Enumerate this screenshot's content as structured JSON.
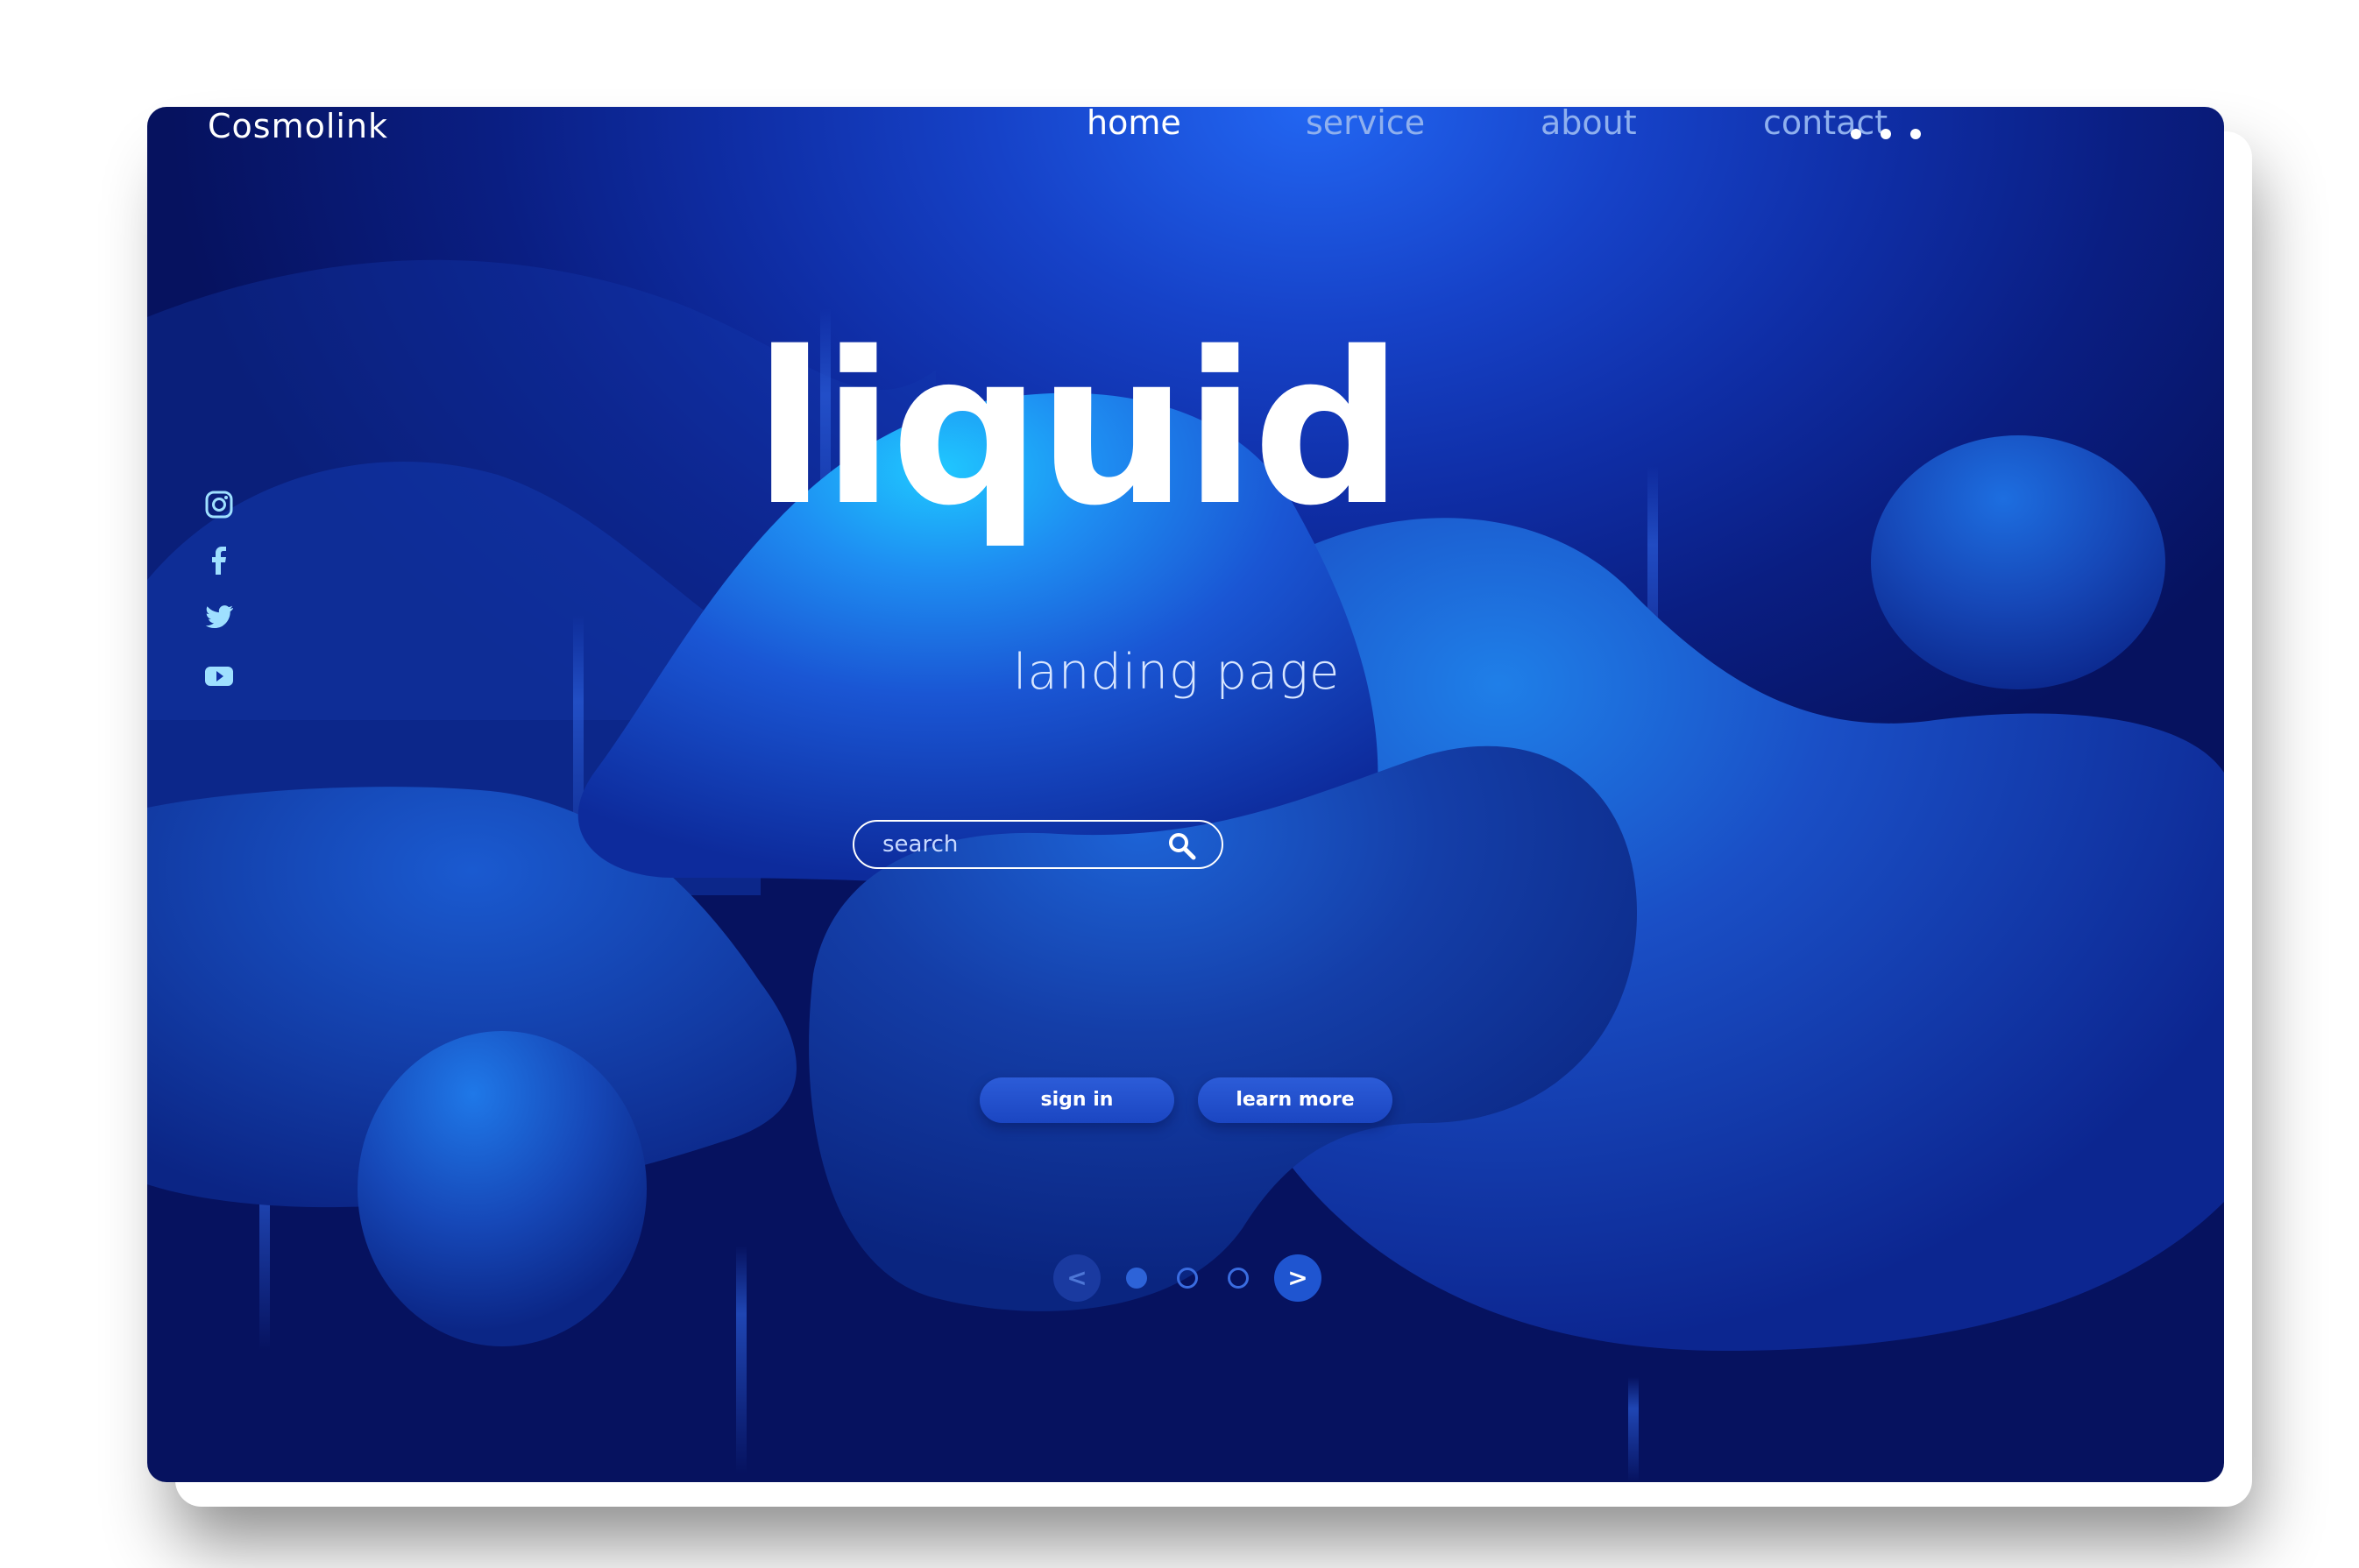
{
  "brand": {
    "name": "Cosmolink"
  },
  "nav": {
    "items": [
      {
        "label": "home",
        "active": true
      },
      {
        "label": "service",
        "active": false
      },
      {
        "label": "about",
        "active": false
      },
      {
        "label": "contact",
        "active": false
      }
    ],
    "more_icon": "more-horizontal-icon"
  },
  "social": {
    "icons": [
      "instagram-icon",
      "facebook-icon",
      "twitter-icon",
      "youtube-icon"
    ]
  },
  "hero": {
    "title": "liquid",
    "subtitle": "landing page"
  },
  "search": {
    "placeholder": "search",
    "value": "",
    "icon": "search-icon"
  },
  "actions": {
    "sign_in_label": "sign in",
    "learn_more_label": "learn more"
  },
  "pager": {
    "prev_label": "<",
    "next_label": ">",
    "total_dots": 3,
    "active_index": 0
  },
  "colors": {
    "background_dark": "#06125f",
    "background_mid": "#1642c8",
    "accent": "#22c8ff",
    "text": "#ffffff",
    "nav_inactive": "#8fb0ee"
  }
}
